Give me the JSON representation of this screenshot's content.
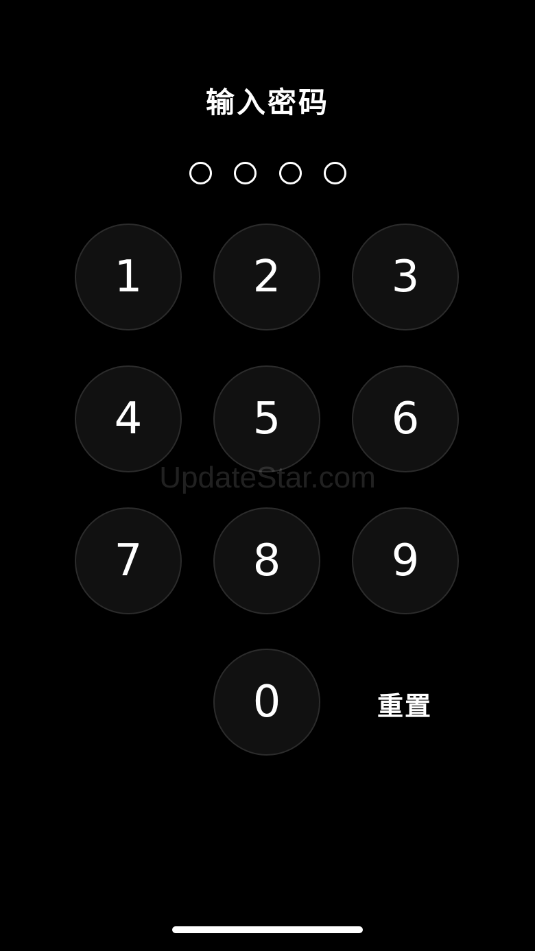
{
  "title": "输入密码",
  "passcode": {
    "length": 4,
    "entered": 0
  },
  "keypad": {
    "keys": [
      "1",
      "2",
      "3",
      "4",
      "5",
      "6",
      "7",
      "8",
      "9",
      "0"
    ],
    "reset_label": "重置"
  },
  "watermark": "UpdateStar.com",
  "colors": {
    "background": "#000000",
    "key_fill": "#111111",
    "key_border": "#2c2c2c",
    "text": "#ffffff"
  }
}
